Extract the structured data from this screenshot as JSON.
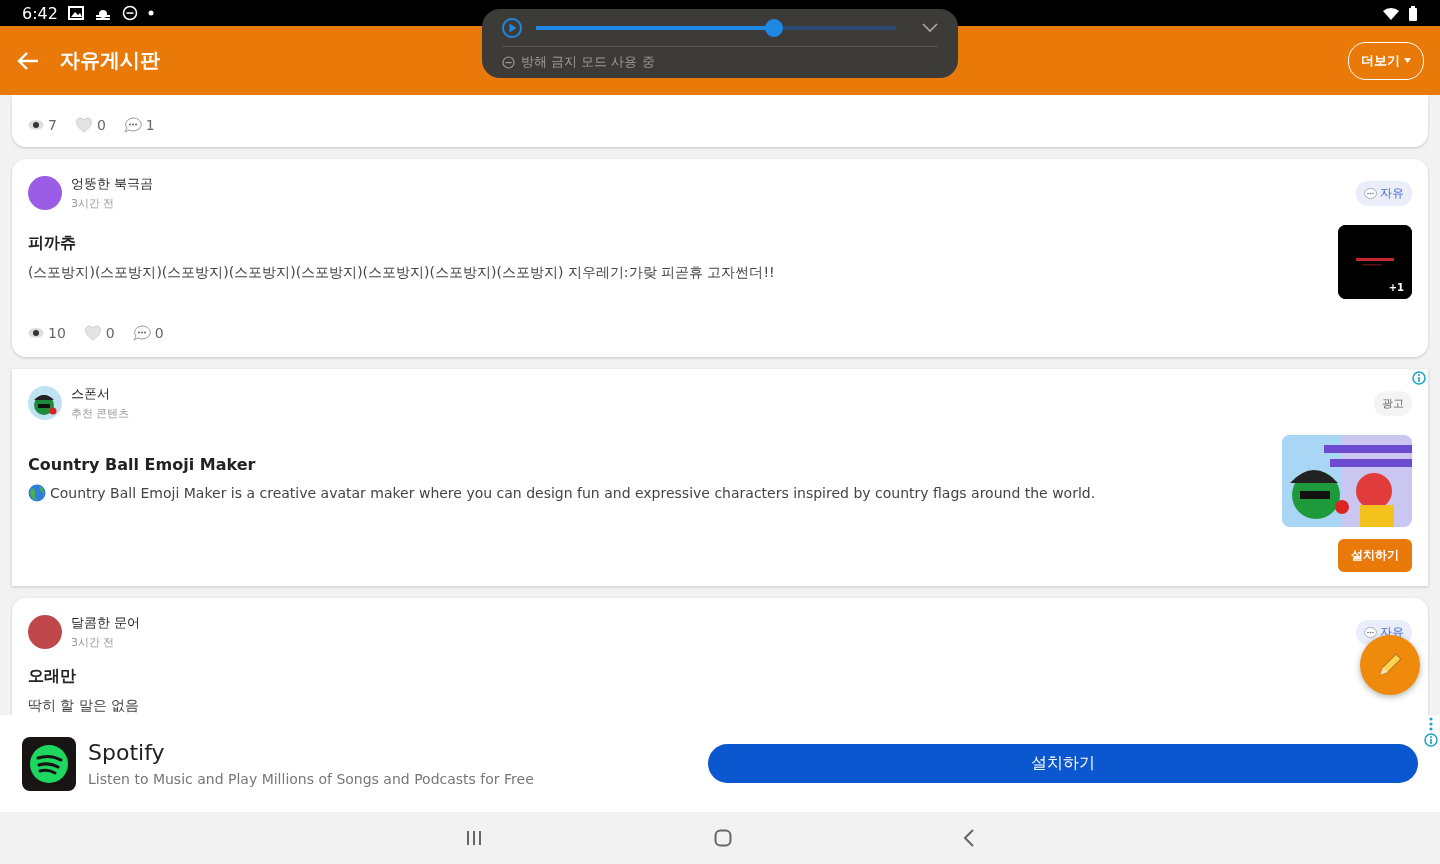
{
  "status_bar": {
    "time": "6:42"
  },
  "media_panel": {
    "level": 0.66,
    "notice": "방해 금지 모드 사용 중"
  },
  "app_bar": {
    "title": "자유게시판",
    "more": "더보기"
  },
  "feed": [
    {
      "kind": "post",
      "views": "7",
      "likes": "0",
      "comments": "1"
    },
    {
      "kind": "post",
      "author": "엉뚱한 북극곰",
      "time": "3시간 전",
      "color": "#9b5de5",
      "tag": "자유",
      "title": "피까츄",
      "body": "(스포방지)(스포방지)(스포방지)(스포방지)(스포방지)(스포방지)(스포방지)(스포방지) 지우레기:가랒 피곧휴 고자썬더!!",
      "thumb_more": "+1",
      "views": "10",
      "likes": "0",
      "comments": "0"
    },
    {
      "kind": "ad",
      "sponsor": "스폰서",
      "subtitle": "추천 콘텐츠",
      "badge": "광고",
      "title": "Country Ball Emoji Maker",
      "body": "Country Ball Emoji Maker is a creative avatar maker where you can design fun and expressive characters inspired by country flags around the world.",
      "button": "설치하기"
    },
    {
      "kind": "post",
      "author": "달콤한 문어",
      "time": "3시간 전",
      "color": "#c0474a",
      "tag": "자유",
      "title": "오래만",
      "body": "딱히 할 말은 없음"
    }
  ],
  "banner_ad": {
    "name": "Spotify",
    "description": "Listen to Music and Play Millions of Songs and Podcasts for Free",
    "button": "설치하기"
  }
}
